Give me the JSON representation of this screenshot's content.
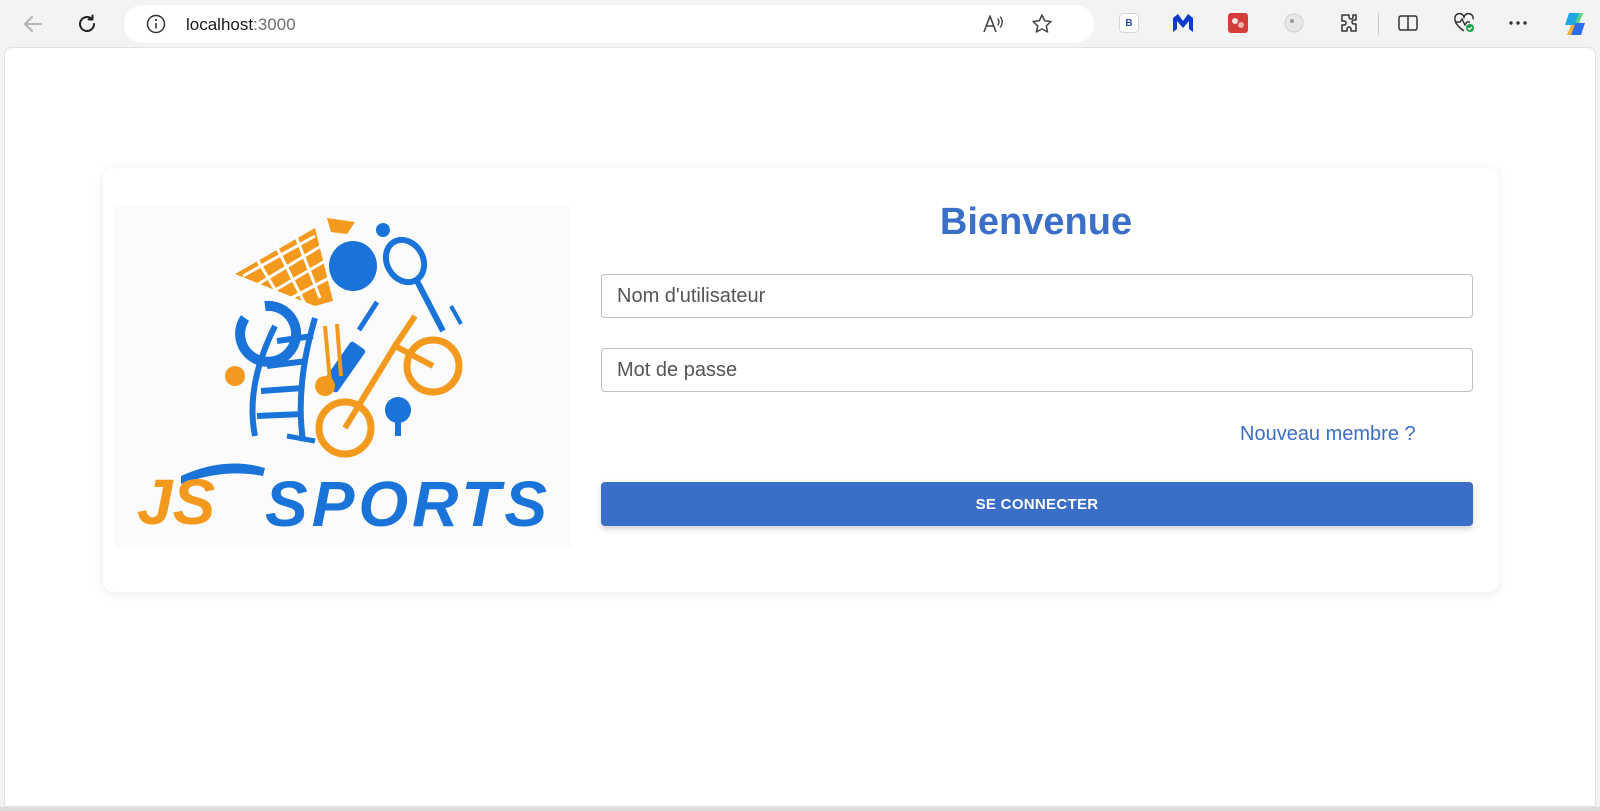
{
  "browser": {
    "url_host": "localhost",
    "url_port": ":3000",
    "icons": {
      "back": "back-arrow-icon",
      "refresh": "refresh-icon",
      "info": "site-info-icon",
      "read_aloud": "read-aloud-icon",
      "favorite": "favorite-star-icon",
      "extensions": "extensions-puzzle-icon",
      "split": "split-screen-icon",
      "health": "browser-essentials-icon",
      "more": "more-options-icon",
      "copilot": "copilot-icon"
    },
    "ext_b_label": "B"
  },
  "login": {
    "title": "Bienvenue",
    "username_placeholder": "Nom d'utilisateur",
    "username_value": "",
    "password_placeholder": "Mot de passe",
    "password_value": "",
    "new_member_link": "Nouveau membre ?",
    "submit_label": "SE CONNECTER"
  },
  "logo": {
    "brand_js": "JS",
    "brand_sports": "SPORTS"
  },
  "colors": {
    "accent": "#3b6fc7",
    "logo_orange": "#f39a1e",
    "logo_blue": "#1a73d9"
  }
}
